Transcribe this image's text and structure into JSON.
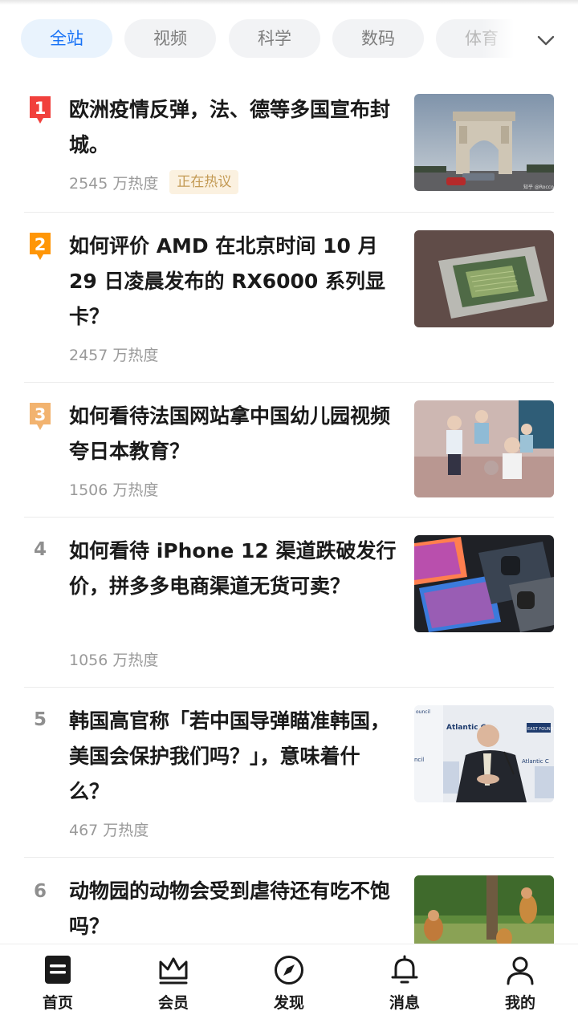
{
  "tabs": [
    {
      "label": "全站",
      "active": true
    },
    {
      "label": "视频",
      "active": false
    },
    {
      "label": "科学",
      "active": false
    },
    {
      "label": "数码",
      "active": false
    },
    {
      "label": "体育",
      "active": false
    }
  ],
  "expand_icon": "chevron-down-icon",
  "items": [
    {
      "rank": "1",
      "title": "欧洲疫情反弹，法、德等多国宣布封城。",
      "heat": "2545 万热度",
      "tag": "正在热议",
      "thumb": "arc-de-triomphe-photo"
    },
    {
      "rank": "2",
      "title": "如何评价 AMD 在北京时间 10 月 29 日凌晨发布的 RX6000 系列显卡？",
      "heat": "2457 万热度",
      "thumb": "gpu-chip-photo"
    },
    {
      "rank": "3",
      "title": "如何看待法国网站拿中国幼儿园视频夸日本教育？",
      "heat": "1506 万热度",
      "thumb": "kindergarten-children-photo"
    },
    {
      "rank": "4",
      "title": "如何看待 iPhone 12 渠道跌破发行价，拼多多电商渠道无货可卖？",
      "heat": "1056 万热度",
      "thumb": "iphone-12-photo"
    },
    {
      "rank": "5",
      "title": "韩国高官称「若中国导弹瞄准韩国，美国会保护我们吗？」，意味着什么？",
      "heat": "467 万热度",
      "thumb": "official-speaking-photo",
      "thumb_text": {
        "brand": "Atlantic Co",
        "side": "Atlantic C",
        "left1": "ouncil",
        "left2": "ncil",
        "badge": "EAST FOUND"
      }
    },
    {
      "rank": "6",
      "title": "动物园的动物会受到虐待还有吃不饱吗？",
      "heat": "",
      "thumb": "monkeys-photo"
    }
  ],
  "thumb_caption_1": "知乎 @Rocco",
  "colors": {
    "accent": "#1772f6",
    "rank1": "#f1403c",
    "rank2": "#ff9607",
    "rank3": "#f2b36f"
  },
  "bottom_nav": [
    {
      "label": "首页",
      "icon": "home-icon",
      "active": true
    },
    {
      "label": "会员",
      "icon": "crown-icon"
    },
    {
      "label": "发现",
      "icon": "compass-icon"
    },
    {
      "label": "消息",
      "icon": "bell-icon"
    },
    {
      "label": "我的",
      "icon": "profile-icon"
    }
  ]
}
